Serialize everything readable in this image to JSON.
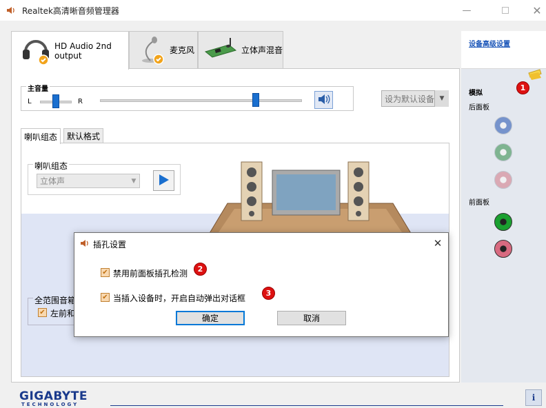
{
  "window": {
    "title": "Realtek高清晰音频管理器",
    "minimize_icon": "minimize-icon",
    "maximize_icon": "maximize-icon",
    "close_icon": "close-icon"
  },
  "tabs": [
    {
      "label": "HD Audio 2nd output",
      "icon": "headphones-icon",
      "active": true
    },
    {
      "label": "麦克风",
      "icon": "microphone-icon",
      "active": false
    },
    {
      "label": "立体声混音",
      "icon": "soundcard-icon",
      "active": false
    }
  ],
  "volume": {
    "label": "主音量",
    "left": "L",
    "right": "R",
    "balance": 0.5,
    "level": 0.77,
    "mute_icon": "speaker-icon"
  },
  "default_device": {
    "label": "设为默认设备"
  },
  "inner_tabs": [
    {
      "label": "喇叭组态",
      "active": true
    },
    {
      "label": "默认格式",
      "active": false
    }
  ],
  "speaker_config": {
    "group_label": "喇叭组态",
    "selected": "立体声",
    "play_icon": "play-icon"
  },
  "fullrange": {
    "label": "全范围音箱",
    "checkbox_label": "左前和",
    "checked": true
  },
  "sidebar": {
    "advanced_link": "设备高级设置",
    "analog_label": "模拟",
    "rear_label": "后面板",
    "front_label": "前面板",
    "rear_jacks": [
      {
        "color": "#5b7fc4",
        "state": "inactive"
      },
      {
        "color": "#66a87a",
        "state": "inactive"
      },
      {
        "color": "#d89aa6",
        "state": "inactive"
      }
    ],
    "front_jacks": [
      {
        "color": "#1aa030",
        "state": "active"
      },
      {
        "color": "#d86a80",
        "state": "active"
      }
    ]
  },
  "badges": [
    "1",
    "2",
    "3"
  ],
  "brand": {
    "name": "GIGABYTE",
    "sub": "TECHNOLOGY",
    "info_icon": "info-icon"
  },
  "dialog": {
    "title": "插孔设置",
    "options": [
      {
        "label": "禁用前面板插孔检测",
        "checked": true
      },
      {
        "label": "当插入设备时，开启自动弹出对话框",
        "checked": true
      }
    ],
    "ok": "确定",
    "cancel": "取消"
  }
}
